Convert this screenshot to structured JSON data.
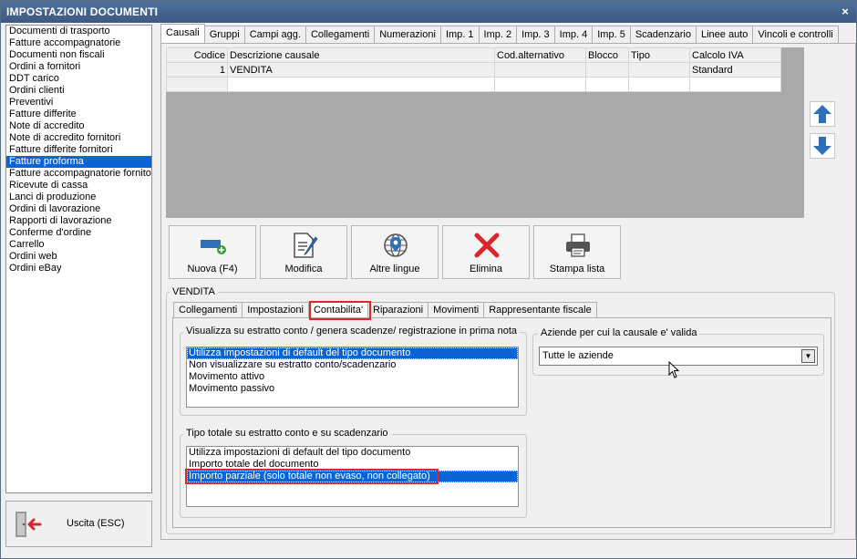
{
  "window": {
    "title": "IMPOSTAZIONI DOCUMENTI",
    "close_label": "×"
  },
  "document_types": [
    {
      "label": "Documenti di trasporto",
      "selected": false
    },
    {
      "label": "Fatture accompagnatorie",
      "selected": false
    },
    {
      "label": "Documenti non fiscali",
      "selected": false
    },
    {
      "label": "Ordini a fornitori",
      "selected": false
    },
    {
      "label": "DDT carico",
      "selected": false
    },
    {
      "label": "Ordini clienti",
      "selected": false
    },
    {
      "label": "Preventivi",
      "selected": false
    },
    {
      "label": "Fatture differite",
      "selected": false
    },
    {
      "label": "Note di accredito",
      "selected": false
    },
    {
      "label": "Note di accredito fornitori",
      "selected": false
    },
    {
      "label": "Fatture differite fornitori",
      "selected": false
    },
    {
      "label": "Fatture proforma",
      "selected": true
    },
    {
      "label": "Fatture accompagnatorie fornito",
      "selected": false
    },
    {
      "label": "Ricevute di cassa",
      "selected": false
    },
    {
      "label": "Lanci di produzione",
      "selected": false
    },
    {
      "label": "Ordini di lavorazione",
      "selected": false
    },
    {
      "label": "Rapporti di lavorazione",
      "selected": false
    },
    {
      "label": "Conferme d'ordine",
      "selected": false
    },
    {
      "label": "Carrello",
      "selected": false
    },
    {
      "label": "Ordini web",
      "selected": false
    },
    {
      "label": "Ordini eBay",
      "selected": false
    }
  ],
  "exit_button": {
    "label": "Uscita (ESC)"
  },
  "top_tabs": [
    {
      "label": "Causali",
      "active": true
    },
    {
      "label": "Gruppi",
      "active": false
    },
    {
      "label": "Campi agg.",
      "active": false
    },
    {
      "label": "Collegamenti",
      "active": false
    },
    {
      "label": "Numerazioni",
      "active": false
    },
    {
      "label": "Imp. 1",
      "active": false
    },
    {
      "label": "Imp. 2",
      "active": false
    },
    {
      "label": "Imp. 3",
      "active": false
    },
    {
      "label": "Imp. 4",
      "active": false
    },
    {
      "label": "Imp. 5",
      "active": false
    },
    {
      "label": "Scadenzario",
      "active": false
    },
    {
      "label": "Linee auto",
      "active": false
    },
    {
      "label": "Vincoli e controlli",
      "active": false
    }
  ],
  "grid": {
    "columns": [
      "Codice",
      "Descrizione causale",
      "Cod.alternativo",
      "Blocco",
      "Tipo",
      "Calcolo IVA"
    ],
    "rows": [
      [
        "1",
        "VENDITA",
        "",
        "",
        "",
        "Standard"
      ],
      [
        "",
        "",
        "",
        "",
        "",
        ""
      ]
    ]
  },
  "toolbar": {
    "new_label": "Nuova (F4)",
    "edit_label": "Modifica",
    "languages_label": "Altre lingue",
    "delete_label": "Elimina",
    "print_label": "Stampa lista"
  },
  "selected_causale_caption": "VENDITA",
  "sub_tabs": [
    {
      "label": "Collegamenti",
      "active": false
    },
    {
      "label": "Impostazioni",
      "active": false
    },
    {
      "label": "Contabilita'",
      "active": true
    },
    {
      "label": "Riparazioni",
      "active": false
    },
    {
      "label": "Movimenti",
      "active": false
    },
    {
      "label": "Rappresentante fiscale",
      "active": false
    }
  ],
  "statement_group": {
    "caption": "Visualizza su estratto conto / genera scadenze/ registrazione  in prima nota",
    "options": [
      {
        "label": "Utilizza impostazioni di default del tipo documento",
        "selected": true
      },
      {
        "label": "Non visualizzare su estratto conto/scadenzario",
        "selected": false
      },
      {
        "label": "Movimento attivo",
        "selected": false
      },
      {
        "label": "Movimento passivo",
        "selected": false
      }
    ]
  },
  "companies_group": {
    "caption": "Aziende per cui la causale e' valida",
    "value": "Tutte le aziende"
  },
  "total_type_group": {
    "caption": "Tipo totale su estratto conto e su scadenzario",
    "options": [
      {
        "label": "Utilizza impostazioni di default del tipo documento",
        "selected": false
      },
      {
        "label": "Importo totale del documento",
        "selected": false
      },
      {
        "label": "Importo parziale (solo totale non evaso, non collegato)",
        "selected": true
      }
    ]
  },
  "colors": {
    "titlebar": "#3c5a82",
    "selection": "#0a64d8",
    "highlight_red": "#e0262b",
    "arrow_blue": "#2f6fb7",
    "delete_red": "#d9262b"
  }
}
